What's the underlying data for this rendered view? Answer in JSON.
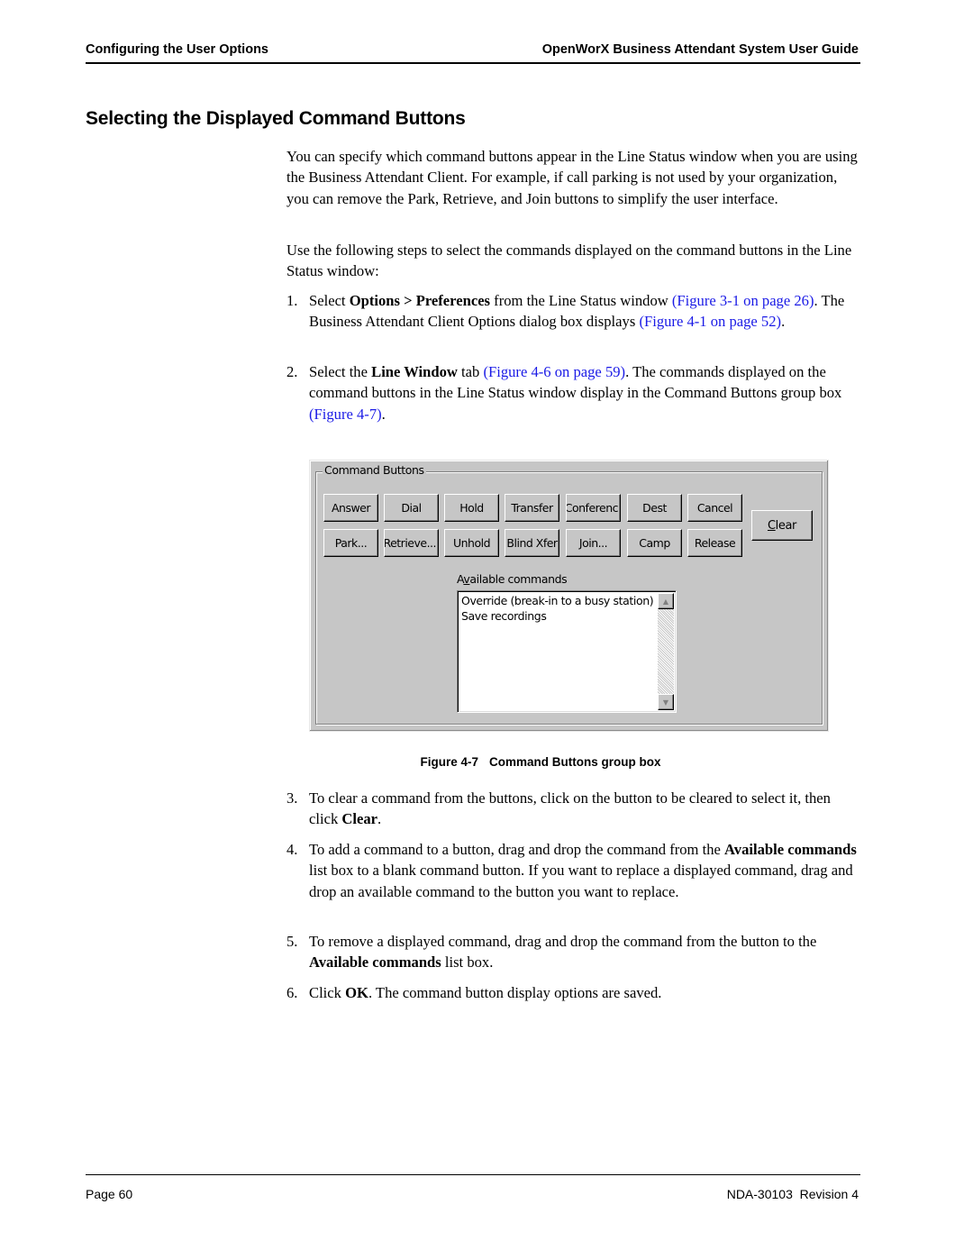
{
  "header": {
    "section": "Configuring the User Options",
    "book_title": "OpenWorX Business Attendant System User Guide"
  },
  "section_title": "Selecting the Displayed Command Buttons",
  "intro": {
    "paragraph1": "You can specify which command buttons appear in the Line Status window when you are using the Business Attendant Client. For example, if call parking is not used by your organization, you can remove the Park, Retrieve, and Join buttons to simplify the user interface.",
    "paragraph2": "Use the following steps to select the commands displayed on the command buttons in the Line Status window:"
  },
  "steps": [
    {
      "number": "1.",
      "t1": "Select ",
      "b1": "Options > Preferences",
      "t2": " from the Line Status window ",
      "link1": "(Figure 3-1 on page 26)",
      "t3": ". The Business Attendant Client Options dialog box displays ",
      "link2": "(Figure 4-1 on page 52)",
      "t4": "."
    },
    {
      "number": "2.",
      "t1": "Select the ",
      "b1": "Line Window",
      "t2": " tab ",
      "link1": "(Figure 4-6 on page 59)",
      "t3": ". The commands displayed on the command buttons in the Line Status window display in the Command Buttons group box ",
      "link2": "(Figure 4-7)",
      "t4": "."
    },
    {
      "number": "3.",
      "t1": "To clear a command from the buttons, click on the button to be cleared to select it, then click ",
      "b1": "Clear",
      "t2": "."
    },
    {
      "number": "4.",
      "t1": "To add a command to a button, drag and drop the command from the ",
      "b1": "Available commands",
      "t2": " list box to a blank command button. If you want to replace a displayed command, drag and drop an available command to the button you want to replace."
    },
    {
      "number": "5.",
      "t1": "To remove a displayed command, drag and drop the command from the button to the ",
      "b1": "Available commands",
      "t2": " list box."
    },
    {
      "number": "6.",
      "t1": "Click ",
      "b1": "OK",
      "t2": ". The command button display options are saved."
    }
  ],
  "figure": {
    "group_label": "Command Buttons",
    "row1": [
      "Answer",
      "Dial",
      "Hold",
      "Transfer",
      "Conferenc",
      "Dest",
      "Cancel"
    ],
    "row2": [
      "Park...",
      "Retrieve...",
      "Unhold",
      "Blind Xfer",
      "Join...",
      "Camp",
      "Release"
    ],
    "clear_button": {
      "underline": "C",
      "rest": "lear"
    },
    "available_label": {
      "pre": "A",
      "underline": "v",
      "post": "ailable commands"
    },
    "available_commands": [
      "Override (break-in to a busy station)",
      "Save recordings"
    ],
    "caption_number": "Figure 4-7",
    "caption_text": "Command Buttons group box"
  },
  "footer": {
    "page": "Page 60",
    "doc_id": "NDA-30103  Revision 4"
  },
  "colors": {
    "link": "#1a1ae6",
    "dialog_gray": "#c6c6c6"
  }
}
